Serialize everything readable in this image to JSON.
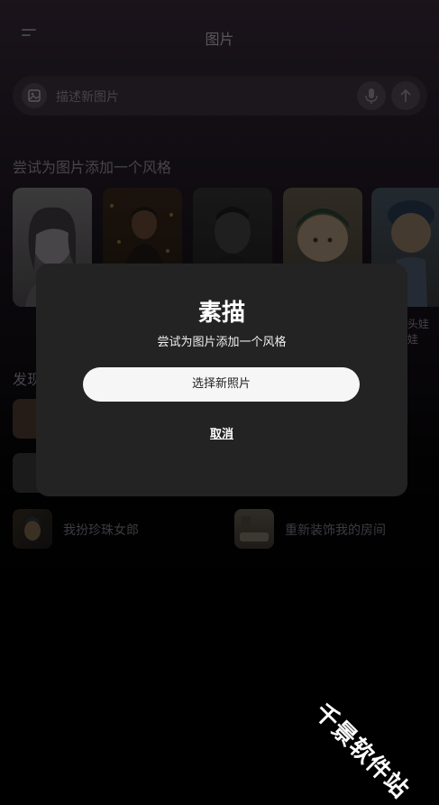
{
  "header": {
    "title": "图片",
    "menu_icon": "menu-icon"
  },
  "search": {
    "placeholder": "描述新图片",
    "image_icon": "image-icon",
    "mic_icon": "mic-icon",
    "send_icon": "arrow-up-icon"
  },
  "styles_section": {
    "title": "尝试为图片添加一个风格",
    "partial_label": "头娃娃"
  },
  "discover": {
    "title": "发现",
    "items": [
      {
        "label": "我扮珍珠女郎"
      },
      {
        "label": "重新装饰我的房间"
      }
    ]
  },
  "modal": {
    "title": "素描",
    "subtitle": "尝试为图片添加一个风格",
    "primary_button": "选择新照片",
    "cancel_button": "取消"
  },
  "watermark": "千景软件站"
}
